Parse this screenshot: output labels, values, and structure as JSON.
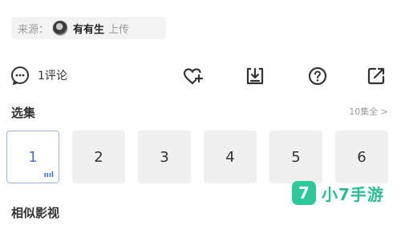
{
  "source": {
    "prefix": "来源：",
    "uploader": "有有生",
    "suffix": "上传"
  },
  "actions": {
    "comment_label": "1评论",
    "icons": [
      "comment-icon",
      "favorite-add-icon",
      "download-icon",
      "help-icon",
      "share-icon"
    ]
  },
  "episodes": {
    "title": "选集",
    "all_label": "10集全 >",
    "items": [
      {
        "label": "1",
        "badge": "ıııl",
        "active": true
      },
      {
        "label": "2"
      },
      {
        "label": "3"
      },
      {
        "label": "4"
      },
      {
        "label": "5"
      },
      {
        "label": "6"
      }
    ]
  },
  "related": {
    "title": "相似影视"
  },
  "watermark": {
    "logo": "7",
    "text": "小7手游"
  },
  "colors": {
    "accent": "#4a72c9",
    "watermark": "#2dc99a",
    "tile_bg": "#f0f0f0"
  }
}
